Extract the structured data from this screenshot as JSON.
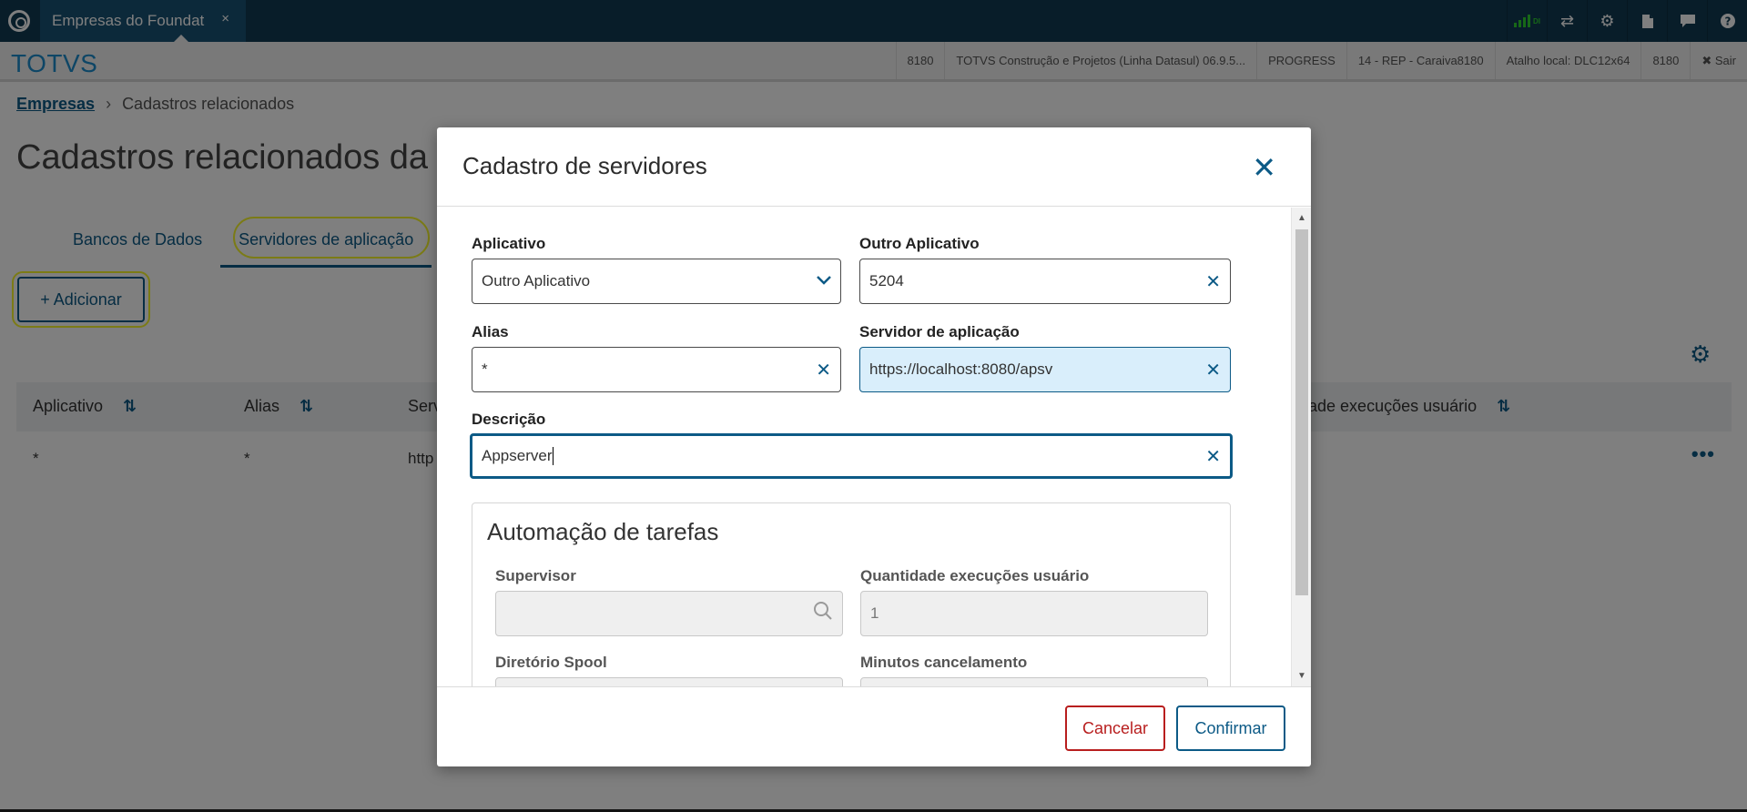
{
  "topbar": {
    "tab_label": "Empresas do Foundat",
    "tab_close": "×",
    "signal_text": "DI",
    "icons": [
      "signal-icon",
      "shuffle-icon",
      "gear-icon",
      "document-icon",
      "chat-icon",
      "help-icon"
    ]
  },
  "header": {
    "brand": "TOTVS",
    "info": [
      "8180",
      "TOTVS Construção e Projetos (Linha Datasul) 06.9.5...",
      "PROGRESS",
      "14 - REP - Caraiva8180",
      "Atalho local: DLC12x64",
      "8180"
    ],
    "exit_label": "✖ Sair"
  },
  "page": {
    "breadcrumb": [
      "Empresas",
      "Cadastros relacionados"
    ],
    "title": "Cadastros relacionados da empresa",
    "tabs": [
      "Bancos de Dados",
      "Servidores de aplicação"
    ],
    "add_label": "+ Adicionar",
    "table": {
      "columns": [
        "Aplicativo",
        "Alias",
        "Serv",
        "tidade execuções usuário"
      ],
      "row": [
        "*",
        "*",
        "http"
      ]
    }
  },
  "modal": {
    "title": "Cadastro de servidores",
    "fields": {
      "aplicativo": {
        "label": "Aplicativo",
        "value": "Outro Aplicativo"
      },
      "outro_aplicativo": {
        "label": "Outro Aplicativo",
        "value": "5204"
      },
      "alias": {
        "label": "Alias",
        "value": "*"
      },
      "servidor": {
        "label": "Servidor de aplicação",
        "value": "https://localhost:8080/apsv"
      },
      "descricao": {
        "label": "Descrição",
        "value": "Appserver"
      }
    },
    "panel": {
      "title": "Automação de tarefas",
      "supervisor_label": "Supervisor",
      "supervisor_value": "",
      "qtd_label": "Quantidade execuções usuário",
      "qtd_value": "1",
      "spool_label": "Diretório Spool",
      "minutos_label": "Minutos cancelamento"
    },
    "cancel_label": "Cancelar",
    "confirm_label": "Confirmar"
  },
  "colors": {
    "topbar": "#103b53",
    "accent": "#0c5a86",
    "brand": "#1c8ccc",
    "danger": "#b81e1e",
    "highlight": "#f6f62c"
  }
}
